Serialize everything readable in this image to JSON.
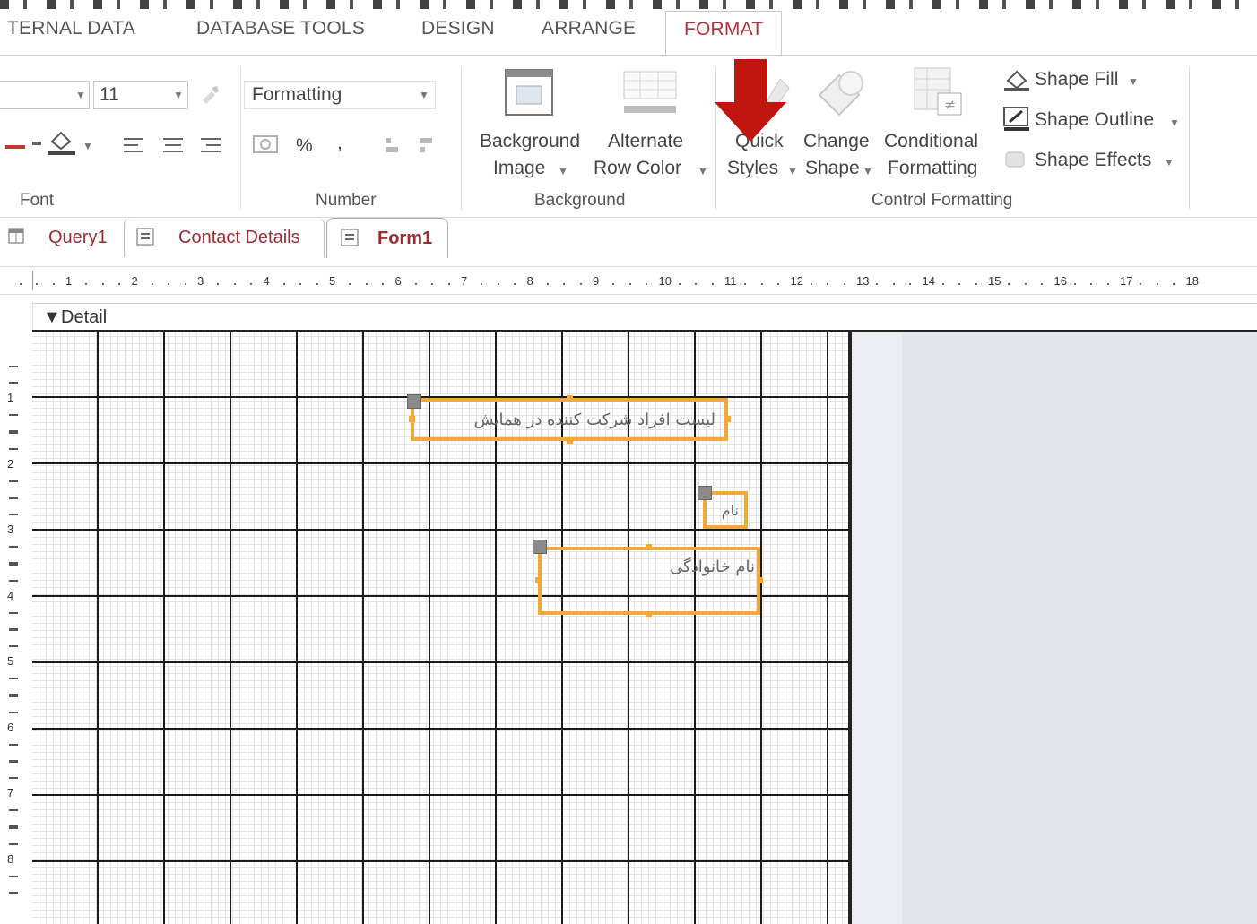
{
  "ribbon_tabs": [
    "TERNAL DATA",
    "DATABASE TOOLS",
    "DESIGN",
    "ARRANGE",
    "FORMAT"
  ],
  "active_tab": "FORMAT",
  "font_group": {
    "size_value": "11",
    "label": "Font"
  },
  "number_group": {
    "format_placeholder": "Formatting",
    "percent_symbol": "%",
    "label": "Number"
  },
  "background_group": {
    "background_image_line1": "Background",
    "background_image_line2": "Image",
    "alt_row_line1": "Alternate",
    "alt_row_line2": "Row Color",
    "label": "Background"
  },
  "control_formatting_group": {
    "quick_styles_line1": "Quick",
    "quick_styles_line2": "Styles",
    "change_shape_line1": "Change",
    "change_shape_line2": "Shape",
    "cond_format_line1": "Conditional",
    "cond_format_line2": "Formatting",
    "shape_fill": "Shape Fill",
    "shape_outline": "Shape Outline",
    "shape_effects": "Shape Effects",
    "label": "Control Formatting"
  },
  "document_tabs": [
    {
      "label": "Query1"
    },
    {
      "label": "Contact Details"
    },
    {
      "label": "Form1"
    }
  ],
  "active_document": "Form1",
  "ruler_numbers": [
    "1",
    "2",
    "3",
    "4",
    "5",
    "6",
    "7",
    "8",
    "9",
    "10",
    "11",
    "12",
    "13",
    "14",
    "15",
    "16",
    "17",
    "18"
  ],
  "vertical_ruler_numbers": [
    "1",
    "2",
    "3",
    "4",
    "5",
    "6",
    "7",
    "8"
  ],
  "section": {
    "detail_label": "Detail"
  },
  "controls": {
    "title_label": "لیست افراد شرکت کننده در همایش",
    "name_label": "نام",
    "family_label": "نام خانوادگی"
  },
  "colors": {
    "accent_tab": "#b0343a",
    "selection_border": "#f2a93b",
    "arrow": "#c0150c",
    "grid_line": "#1a1a1a"
  }
}
